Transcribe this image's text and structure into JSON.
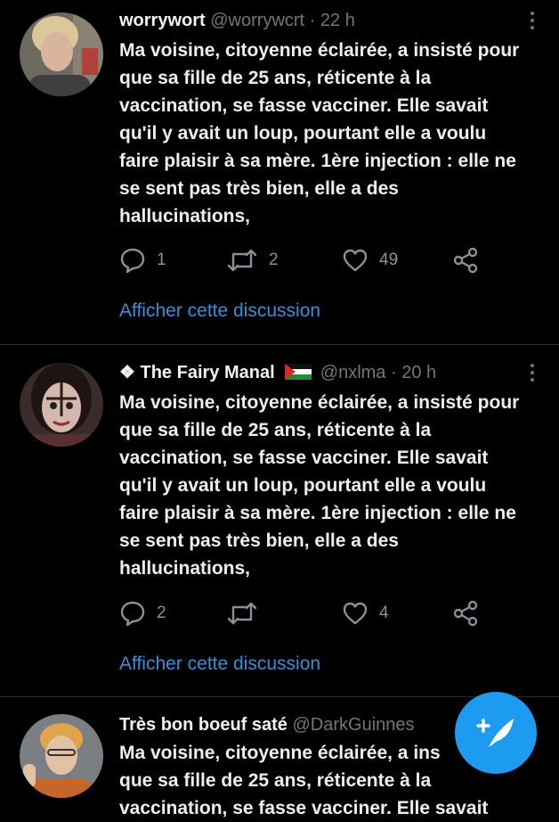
{
  "tweets": [
    {
      "name": "worrywort",
      "handle": "@worrywcrt",
      "time": "22 h",
      "text": "Ma voisine, citoyenne éclairée, a insisté pour\nque sa fille de 25 ans, réticente à la\nvaccination, se fasse vacciner. Elle savait\nqu'il y avait un loup, pourtant elle a voulu\nfaire plaisir à sa mère. 1ère injection : elle ne\nse sent pas très bien, elle a des\nhallucinations,",
      "replies": "1",
      "retweets": "2",
      "likes": "49",
      "discussion": "Afficher cette discussion"
    },
    {
      "name": "❖ The Fairy Manal",
      "handle": "@nxlma",
      "time": "20 h",
      "text": "Ma voisine, citoyenne éclairée, a insisté pour\nque sa fille de 25 ans, réticente à la\nvaccination, se fasse vacciner. Elle savait\nqu'il y avait un loup, pourtant elle a voulu\nfaire plaisir à sa mère. 1ère injection : elle ne\nse sent pas très bien, elle a des\nhallucinations,",
      "replies": "2",
      "retweets": "",
      "likes": "4",
      "discussion": "Afficher cette discussion"
    },
    {
      "name": "Très bon boeuf saté",
      "handle": "@DarkGuinnes",
      "time": "",
      "text": "Ma voisine, citoyenne éclairée, a ins\nque sa fille de 25 ans, réticente à la\nvaccination, se fasse vacciner. Elle savait",
      "replies": "",
      "retweets": "",
      "likes": "",
      "discussion": ""
    }
  ],
  "flag_icon": "palestine-flag-icon",
  "fab_icon": "compose-tweet-icon",
  "colors": {
    "accent": "#1d9bf0",
    "link": "#3a8fd6",
    "muted": "#71767b",
    "background": "#000000"
  }
}
